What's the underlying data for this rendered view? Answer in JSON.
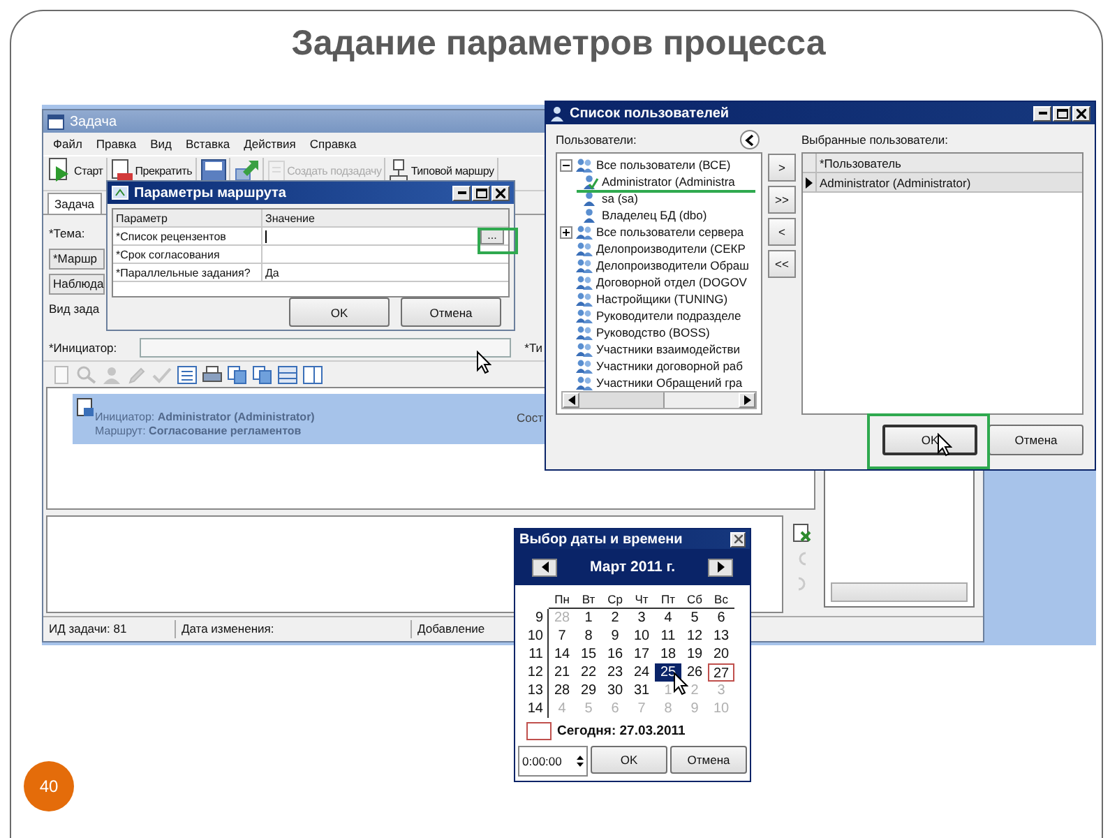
{
  "slide": {
    "title": "Задание параметров процесса",
    "page_number": "40"
  },
  "task_window": {
    "title": "Задача",
    "menu": [
      "Файл",
      "Правка",
      "Вид",
      "Вставка",
      "Действия",
      "Справка"
    ],
    "toolbar": [
      {
        "kind": "start",
        "label": "Старт",
        "disabled": false
      },
      {
        "kind": "stop",
        "label": "Прекратить",
        "disabled": false
      },
      {
        "kind": "save",
        "disabled": false
      },
      {
        "kind": "send",
        "disabled": false
      },
      {
        "kind": "subtask",
        "label": "Создать подзадачу",
        "disabled": true
      },
      {
        "kind": "route",
        "label": "Типовой маршру",
        "disabled": false
      }
    ],
    "tabs": [
      {
        "label": "Задача",
        "selected": true
      }
    ],
    "form_rows": [
      {
        "kind": "label",
        "text": "*Тема:"
      },
      {
        "kind": "button",
        "text": "*Маршр"
      },
      {
        "kind": "button",
        "text": "Наблюда"
      },
      {
        "kind": "label",
        "text": "Вид зада"
      }
    ],
    "initiator_label": "*Инициатор:",
    "side_label": "*Ти",
    "task_list": [
      {
        "initiator": "Инициатор: **Administrator (Administrator)**",
        "route": "Маршрут: **Согласование регламентов**",
        "state": "Сост",
        "selected": true
      }
    ],
    "status_bar": [
      "ИД задачи: 81",
      "Дата изменения:",
      "Добавление"
    ]
  },
  "route_dialog": {
    "title": "Параметры маршрута",
    "columns": [
      "Параметр",
      "Значение"
    ],
    "rows": [
      {
        "parameter": "*Список рецензентов",
        "kind": "lookup",
        "button": "..."
      },
      {
        "parameter": "*Срок согласования",
        "kind": "text"
      },
      {
        "parameter": "*Параллельные задания?",
        "kind": "text",
        "value": "Да"
      }
    ],
    "buttons": [
      "OK",
      "Отмена"
    ]
  },
  "users_dialog": {
    "title": "Список пользователей",
    "users_label": "Пользователи:",
    "selected_label": "Выбранные пользователи:",
    "tree": [
      {
        "label": "Все пользователи (ВСЕ)",
        "kind": "group-node",
        "expanded": true,
        "children": [
          {
            "label": "Administrator (Administra",
            "kind": "user",
            "checked": true
          },
          {
            "label": "sa (sa)",
            "kind": "user",
            "checked": false
          },
          {
            "label": "Владелец БД (dbo)",
            "kind": "user",
            "checked": false
          }
        ]
      },
      {
        "label": "Все пользователи сервера",
        "kind": "group-node",
        "expanded": false
      },
      {
        "label": "Делопроизводители (СЕКР",
        "kind": "group"
      },
      {
        "label": "Делопроизводители Обраш",
        "kind": "group"
      },
      {
        "label": "Договорной отдел (DOGOV",
        "kind": "group"
      },
      {
        "label": "Настройщики (TUNING)",
        "kind": "group"
      },
      {
        "label": "Руководители подразделе",
        "kind": "group"
      },
      {
        "label": "Руководство (BOSS)",
        "kind": "group"
      },
      {
        "label": "Участники взаимодействи",
        "kind": "group"
      },
      {
        "label": "Участники договорной раб",
        "kind": "group"
      },
      {
        "label": "Участники Обращений гра",
        "kind": "group"
      }
    ],
    "move_buttons": [
      ">",
      ">>",
      "<",
      "<<"
    ],
    "selected_column": "*Пользователь",
    "selected_rows": [
      {
        "name": "Administrator (Administrator)",
        "selected": true
      }
    ],
    "buttons": [
      {
        "label": "OK",
        "focused": true
      },
      {
        "label": "Отмена",
        "focused": false
      }
    ]
  },
  "date_dialog": {
    "title": "Выбор даты и времени",
    "month": "Март 2011 г.",
    "weekdays": [
      "Пн",
      "Вт",
      "Ср",
      "Чт",
      "Пт",
      "Сб",
      "Вс"
    ],
    "weeks": [
      {
        "week": "9",
        "days": [
          {
            "day": "28",
            "other_month": true,
            "selected": false,
            "today": false
          },
          {
            "day": "1",
            "other_month": false,
            "selected": false,
            "today": false
          },
          {
            "day": "2",
            "other_month": false,
            "selected": false,
            "today": false
          },
          {
            "day": "3",
            "other_month": false,
            "selected": false,
            "today": false
          },
          {
            "day": "4",
            "other_month": false,
            "selected": false,
            "today": false
          },
          {
            "day": "5",
            "other_month": false,
            "selected": false,
            "today": false
          },
          {
            "day": "6",
            "other_month": false,
            "selected": false,
            "today": false
          }
        ]
      },
      {
        "week": "10",
        "days": [
          {
            "day": "7",
            "other_month": false,
            "selected": false,
            "today": false
          },
          {
            "day": "8",
            "other_month": false,
            "selected": false,
            "today": false
          },
          {
            "day": "9",
            "other_month": false,
            "selected": false,
            "today": false
          },
          {
            "day": "10",
            "other_month": false,
            "selected": false,
            "today": false
          },
          {
            "day": "11",
            "other_month": false,
            "selected": false,
            "today": false
          },
          {
            "day": "12",
            "other_month": false,
            "selected": false,
            "today": false
          },
          {
            "day": "13",
            "other_month": false,
            "selected": false,
            "today": false
          }
        ]
      },
      {
        "week": "11",
        "days": [
          {
            "day": "14",
            "other_month": false,
            "selected": false,
            "today": false
          },
          {
            "day": "15",
            "other_month": false,
            "selected": false,
            "today": false
          },
          {
            "day": "16",
            "other_month": false,
            "selected": false,
            "today": false
          },
          {
            "day": "17",
            "other_month": false,
            "selected": false,
            "today": false
          },
          {
            "day": "18",
            "other_month": false,
            "selected": false,
            "today": false
          },
          {
            "day": "19",
            "other_month": false,
            "selected": false,
            "today": false
          },
          {
            "day": "20",
            "other_month": false,
            "selected": false,
            "today": false
          }
        ]
      },
      {
        "week": "12",
        "days": [
          {
            "day": "21",
            "other_month": false,
            "selected": false,
            "today": false
          },
          {
            "day": "22",
            "other_month": false,
            "selected": false,
            "today": false
          },
          {
            "day": "23",
            "other_month": false,
            "selected": false,
            "today": false
          },
          {
            "day": "24",
            "other_month": false,
            "selected": false,
            "today": false
          },
          {
            "day": "25",
            "other_month": false,
            "selected": true,
            "today": false
          },
          {
            "day": "26",
            "other_month": false,
            "selected": false,
            "today": false
          },
          {
            "day": "27",
            "other_month": false,
            "selected": false,
            "today": true
          }
        ]
      },
      {
        "week": "13",
        "days": [
          {
            "day": "28",
            "other_month": false,
            "selected": false,
            "today": false
          },
          {
            "day": "29",
            "other_month": false,
            "selected": false,
            "today": false
          },
          {
            "day": "30",
            "other_month": false,
            "selected": false,
            "today": false
          },
          {
            "day": "31",
            "other_month": false,
            "selected": false,
            "today": false
          },
          {
            "day": "1",
            "other_month": true,
            "selected": false,
            "today": false
          },
          {
            "day": "2",
            "other_month": true,
            "selected": false,
            "today": false
          },
          {
            "day": "3",
            "other_month": true,
            "selected": false,
            "today": false
          }
        ]
      },
      {
        "week": "14",
        "days": [
          {
            "day": "4",
            "other_month": true,
            "selected": false,
            "today": false
          },
          {
            "day": "5",
            "other_month": true,
            "selected": false,
            "today": false
          },
          {
            "day": "6",
            "other_month": true,
            "selected": false,
            "today": false
          },
          {
            "day": "7",
            "other_month": true,
            "selected": false,
            "today": false
          },
          {
            "day": "8",
            "other_month": true,
            "selected": false,
            "today": false
          },
          {
            "day": "9",
            "other_month": true,
            "selected": false,
            "today": false
          },
          {
            "day": "10",
            "other_month": true,
            "selected": false,
            "today": false
          }
        ]
      }
    ],
    "today_label": "Сегодня: 27.03.2011",
    "time": "0:00:00",
    "buttons": [
      "OK",
      "Отмена"
    ]
  }
}
